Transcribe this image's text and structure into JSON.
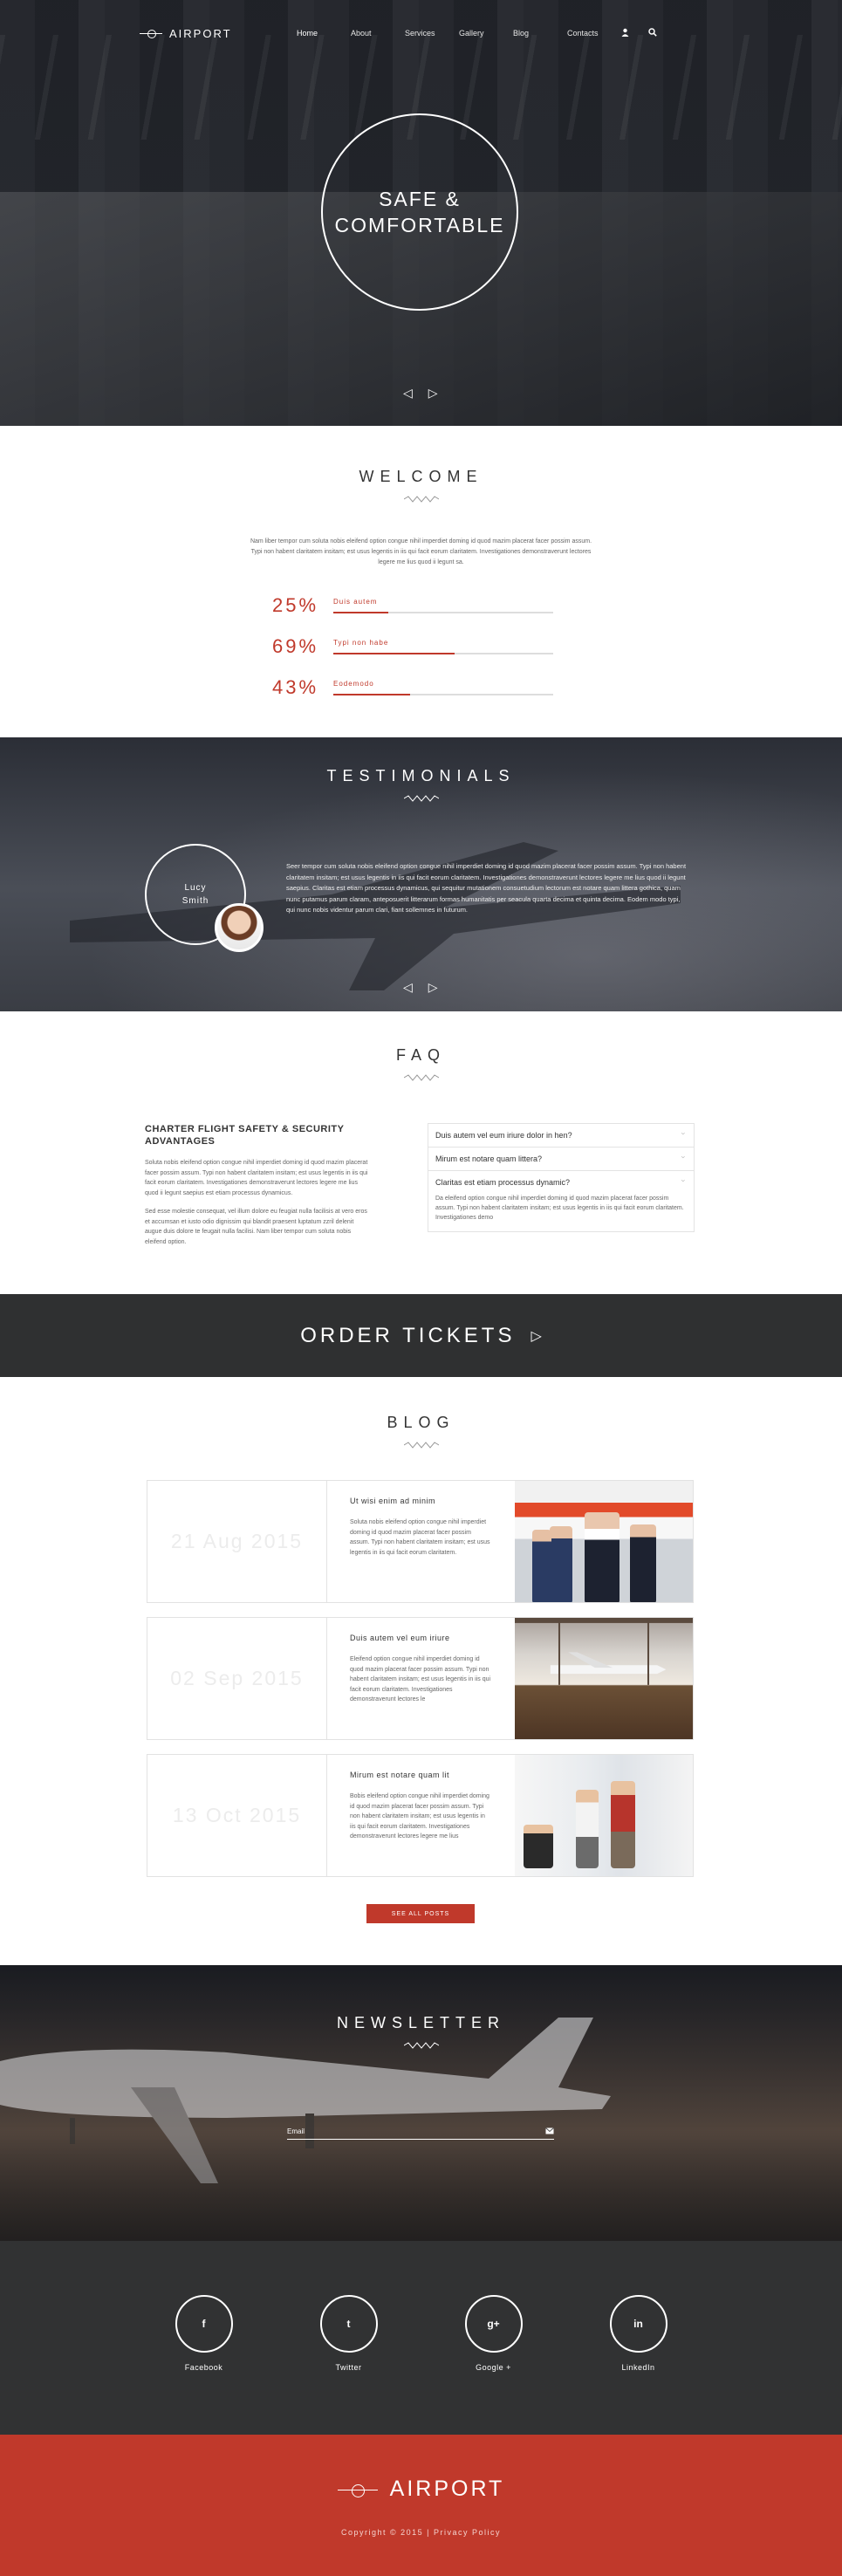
{
  "header": {
    "logo": "AIRPORT",
    "nav": [
      "Home",
      "About",
      "Services",
      "Gallery",
      "Blog",
      "Contacts"
    ],
    "icons": [
      "user-icon",
      "search-icon"
    ]
  },
  "hero": {
    "line1": "SAFE &",
    "line2": "COMFORTABLE",
    "prev": "◁",
    "next": "▷"
  },
  "welcome": {
    "title": "WELCOME",
    "text": "Nam liber tempor cum soluta nobis eleifend option congue nihil imperdiet doming id quod mazim placerat facer possim assum. Typi non habent claritatem insitam; est usus legentis in iis qui facit eorum claritatem. Investigationes demonstraverunt lectores legere me lius quod ii legunt sa.",
    "stats": [
      {
        "value": "25%",
        "label": "Duis autem",
        "level": 0.25
      },
      {
        "value": "69%",
        "label": "Typi non habe",
        "level": 0.55
      },
      {
        "value": "43%",
        "label": "Eodemodo",
        "level": 0.35
      }
    ]
  },
  "testimonials": {
    "title": "TESTIMONIALS",
    "first_name": "Lucy",
    "last_name": "Smith",
    "quote": "Seer tempor cum soluta nobis eleifend option congue nihil imperdiet doming id quod mazim placerat facer possim assum. Typi non habent claritatem insitam; est usus legentis in iis qui facit eorum claritatem. Investigationes demonstraverunt lectores legere me lius quod ii legunt saepius. Claritas est etiam processus dynamicus, qui sequitur mutationem consuetudium lectorum est notare quam littera gothica, quam nunc putamus parum claram, anteposuerit litterarum formas humanitatis per seacula quarta decima et quinta decima. Eodem modo typi, qui nunc nobis videntur parum clari, fiant sollemnes in futurum.",
    "prev": "◁",
    "next": "▷"
  },
  "faq": {
    "title": "FAQ",
    "heading": "CHARTER FLIGHT SAFETY & SECURITY ADVANTAGES",
    "para1": "Soluta nobis eleifend option congue nihil imperdiet doming id quod mazim placerat facer possim assum. Typi non habent claritatem insitam; est usus legentis in iis qui facit eorum claritatem. Investigationes demonstraverunt lectores legere me lius quod ii legunt saepius est etiam processus dynamicus.",
    "para2": "Sed esse molestie consequat, vel illum dolore eu feugiat nulla facilisis at vero eros et accumsan et iusto odio dignissim qui blandit praesent luptatum zzril delenit augue duis dolore te feugait nulla facilisi. Nam liber tempor cum soluta nobis eleifend option.",
    "items": [
      "Duis autem vel eum iriure dolor in hen?",
      "Mirum est notare quam littera?",
      "Claritas est etiam processus dynamic?"
    ],
    "answer": "Da eleifend option congue nihil imperdiet doming id quod mazim placerat facer possim assum. Typi non habent claritatem insitam; est usus legentis in iis qui facit eorum claritatem. Investigationes demo"
  },
  "order": {
    "label": "ORDER TICKETS",
    "arrow": "▷"
  },
  "blog": {
    "title": "BLOG",
    "posts": [
      {
        "date": "21 Aug 2015",
        "title": "Ut wisi enim ad minim",
        "text": "Soluta nobis eleifend option congue nihil imperdiet doming id quod mazim placerat facer possim assum. Typi non habent claritatem insitam; est usus legentis in iis qui facit eorum claritatem."
      },
      {
        "date": "02 Sep 2015",
        "title": "Duis autem vel eum iriure",
        "text": "Eleifend option congue nihil imperdiet doming id quod mazim placerat facer possim assum. Typi non habent claritatem insitam; est usus legentis in iis qui facit eorum claritatem. Investigationes demonstraverunt lectores le"
      },
      {
        "date": "13 Oct 2015",
        "title": "Mirum est notare quam lit",
        "text": "Bobis eleifend option congue nihil imperdiet doming id quod mazim placerat facer possim assum. Typi non habent claritatem insitam; est usus legentis in iis qui facit eorum claritatem. Investigationes demonstraverunt lectores legere me lius"
      }
    ],
    "see_all": "SEE ALL POSTS"
  },
  "newsletter": {
    "title": "NEWSLETTER",
    "placeholder": "Email",
    "icon": "envelope-icon"
  },
  "social": [
    {
      "label": "Facebook",
      "glyph": "f",
      "icon": "facebook-icon"
    },
    {
      "label": "Twitter",
      "glyph": "t",
      "icon": "twitter-icon"
    },
    {
      "label": "Google +",
      "glyph": "g+",
      "icon": "google-plus-icon"
    },
    {
      "label": "LinkedIn",
      "glyph": "in",
      "icon": "linkedin-icon"
    }
  ],
  "footer": {
    "logo": "AIRPORT",
    "copyright": "Copyright © 2015 | Privacy Policy"
  },
  "colors": {
    "accent": "#c0392b",
    "dark": "#313233"
  }
}
